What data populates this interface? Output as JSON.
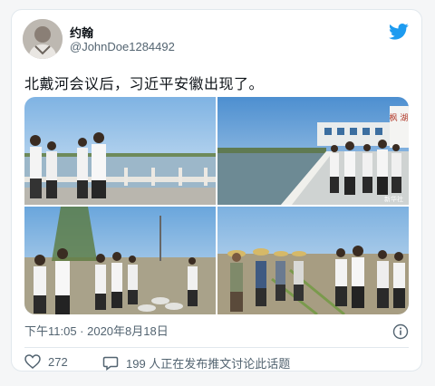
{
  "author": {
    "name": "约翰",
    "handle": "@JohnDoe1284492"
  },
  "tweet": {
    "text": "北戴河会议后，习近平安徽出现了。"
  },
  "photos": [
    {
      "label": "photo-riverside"
    },
    {
      "label": "photo-sluice"
    },
    {
      "label": "photo-field-1"
    },
    {
      "label": "photo-field-2"
    }
  ],
  "watermark": "新华社",
  "sign_text": "枫 湖",
  "meta": {
    "timestamp": "下午11:05 · 2020年8月18日"
  },
  "actions": {
    "likes": "272",
    "discussion": "199 人正在发布推文讨论此话题"
  },
  "icons": {
    "brand": "twitter-bird-icon",
    "info": "info-icon",
    "like": "heart-icon",
    "reply": "comment-icon"
  },
  "colors": {
    "brand": "#1d9bf0",
    "muted": "#536471",
    "border": "#e1e8ed"
  }
}
